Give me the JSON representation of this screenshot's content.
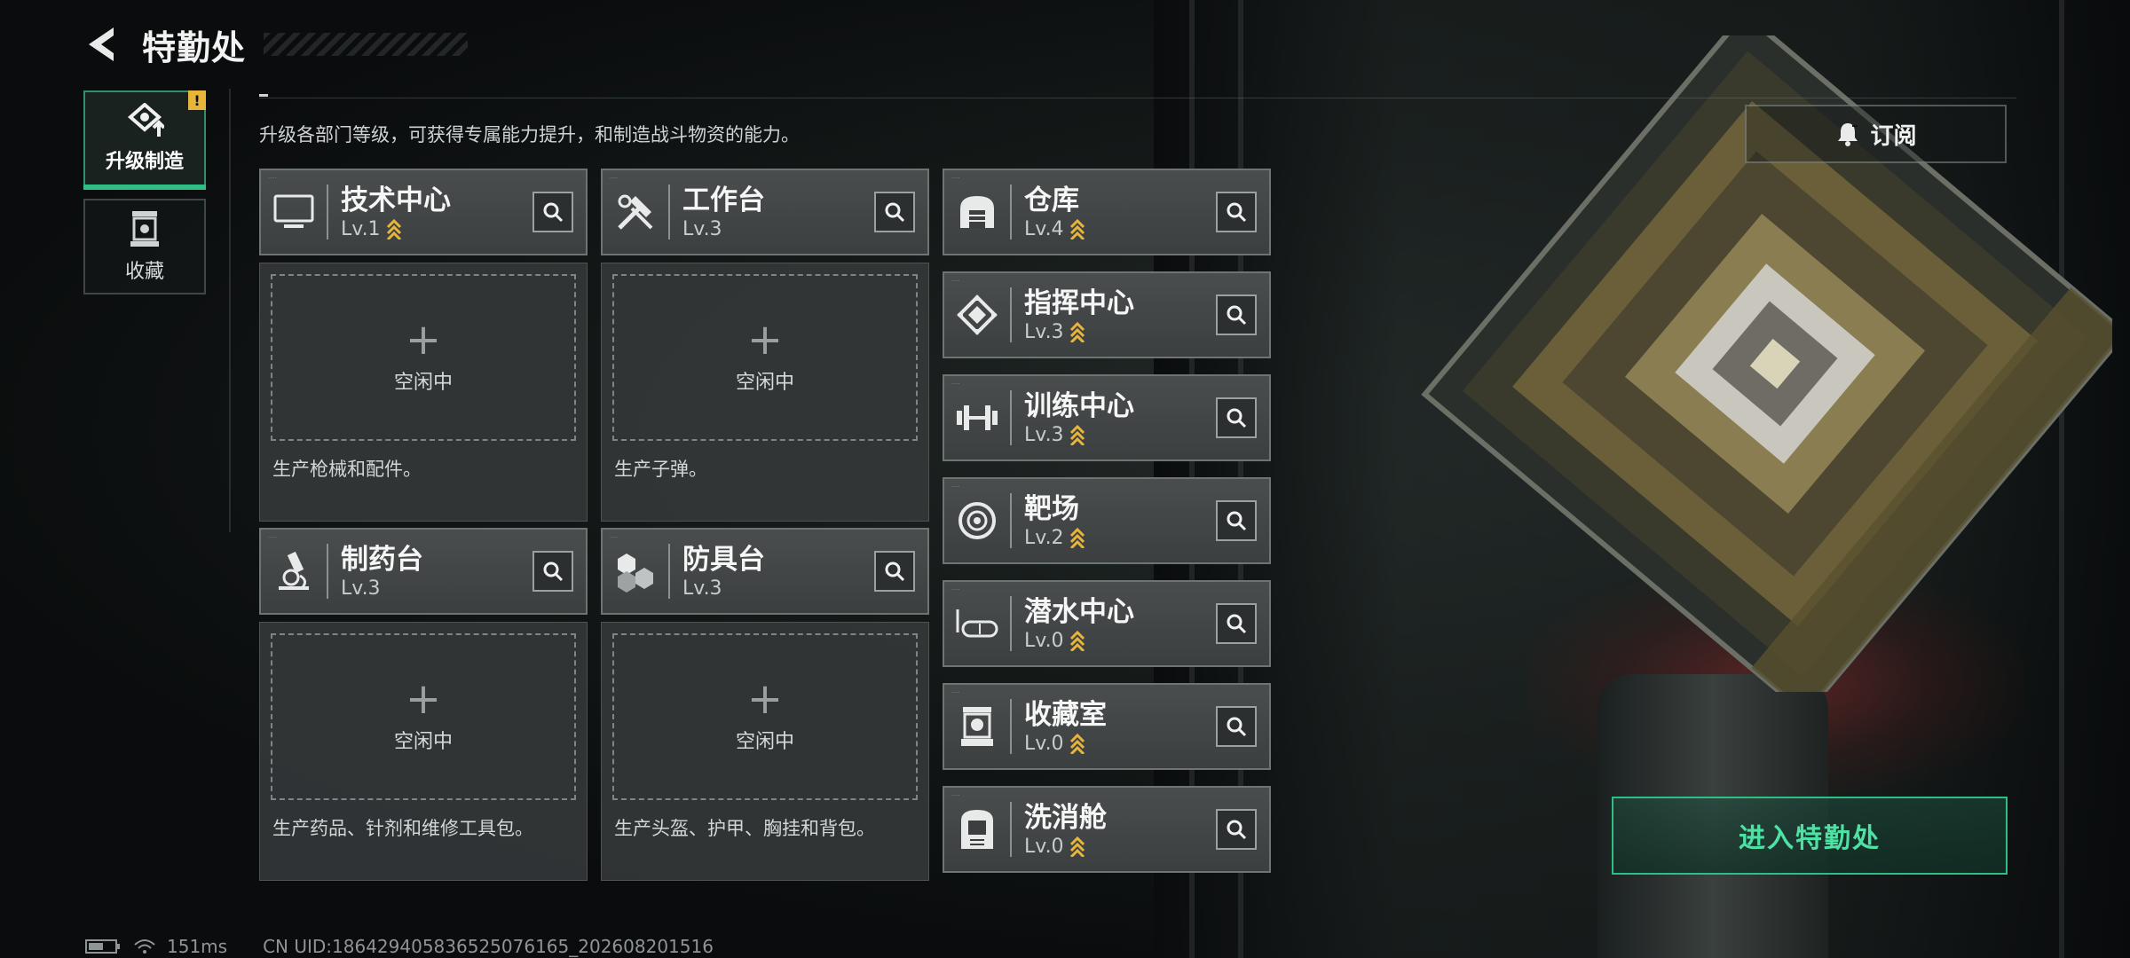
{
  "header": {
    "title": "特勤处"
  },
  "sidenav": [
    {
      "label": "升级制造",
      "active": true,
      "badge": "!"
    },
    {
      "label": "收藏",
      "active": false
    }
  ],
  "intro": "升级各部门等级，可获得专属能力提升，和制造战斗物资的能力。",
  "subscribe_label": "订阅",
  "production_cards": [
    {
      "name": "技术中心",
      "level": "Lv.1",
      "upgradable": true,
      "idle_label": "空闲中",
      "desc": "生产枪械和配件。",
      "icon": "monitor-icon"
    },
    {
      "name": "工作台",
      "level": "Lv.3",
      "upgradable": false,
      "idle_label": "空闲中",
      "desc": "生产子弹。",
      "icon": "tools-icon"
    },
    {
      "name": "制药台",
      "level": "Lv.3",
      "upgradable": false,
      "idle_label": "空闲中",
      "desc": "生产药品、针剂和维修工具包。",
      "icon": "microscope-icon"
    },
    {
      "name": "防具台",
      "level": "Lv.3",
      "upgradable": false,
      "idle_label": "空闲中",
      "desc": "生产头盔、护甲、胸挂和背包。",
      "icon": "armor-blocks-icon"
    }
  ],
  "facilities": [
    {
      "name": "仓库",
      "level": "Lv.4",
      "upgradable": true,
      "icon": "warehouse-icon"
    },
    {
      "name": "指挥中心",
      "level": "Lv.3",
      "upgradable": true,
      "icon": "command-chip-icon"
    },
    {
      "name": "训练中心",
      "level": "Lv.3",
      "upgradable": true,
      "icon": "dumbbell-icon"
    },
    {
      "name": "靶场",
      "level": "Lv.2",
      "upgradable": true,
      "icon": "target-icon"
    },
    {
      "name": "潜水中心",
      "level": "Lv.0",
      "upgradable": true,
      "icon": "diving-mask-icon"
    },
    {
      "name": "收藏室",
      "level": "Lv.0",
      "upgradable": true,
      "icon": "trophy-case-icon"
    },
    {
      "name": "洗消舱",
      "level": "Lv.0",
      "upgradable": true,
      "icon": "decon-pod-icon"
    }
  ],
  "enter_label": "进入特勤处",
  "status": {
    "ping": "151ms",
    "uid": "CN UID:18642940583652507​6165_202608201516"
  },
  "colors": {
    "accent": "#2fbf86",
    "upgrade_arrow": "#e7b53a",
    "card_bg": "#3f4243"
  }
}
